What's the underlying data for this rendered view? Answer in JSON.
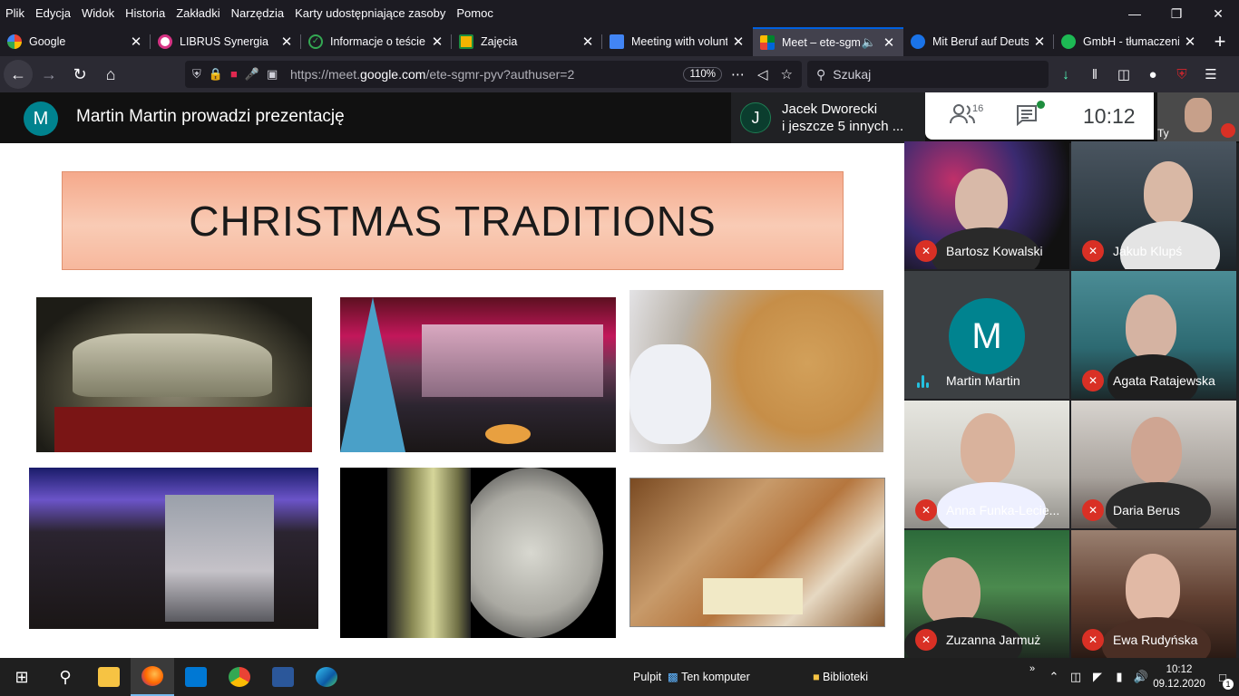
{
  "menubar": {
    "items": [
      "Plik",
      "Edycja",
      "Widok",
      "Historia",
      "Zakładki",
      "Narzędzia",
      "Karty udostępniające zasoby",
      "Pomoc"
    ]
  },
  "tabs": [
    {
      "label": "Google",
      "icon": "google-icon",
      "color": "#4285f4"
    },
    {
      "label": "LIBRUS Synergia",
      "icon": "librus-icon",
      "color": "#d63384"
    },
    {
      "label": "Informacje o teście",
      "icon": "check-icon",
      "color": "#1e8e3e"
    },
    {
      "label": "Zajęcia",
      "icon": "classroom-icon",
      "color": "#f4b400"
    },
    {
      "label": "Meeting with volunt",
      "icon": "contacts-icon",
      "color": "#4285f4"
    },
    {
      "label": "Meet – ete-sgmr",
      "icon": "meet-icon",
      "color": "#00832d"
    },
    {
      "label": "Mit Beruf auf Deuts",
      "icon": "globe-icon",
      "color": "#1a73e8"
    },
    {
      "label": "GmbH - tłumaczeni",
      "icon": "circle-icon",
      "color": "#1db954"
    }
  ],
  "navbar": {
    "url_prefix": "https://meet.",
    "url_domain": "google.com",
    "url_path": "/ete-sgmr-pyv?authuser=2",
    "zoom": "110%",
    "search_placeholder": "Szukaj"
  },
  "meet": {
    "presenter_initial": "M",
    "presenter_text": "Martin Martin prowadzi prezentację",
    "joined_initial": "J",
    "joined_line1": "Jacek Dworecki",
    "joined_line2": "i jeszcze 5 innych ...",
    "participant_count": "16",
    "time": "10:12",
    "self_label": "Ty",
    "slide_title": "CHRISTMAS TRADITIONS",
    "participants": [
      {
        "name": "Bartosz Kowalski",
        "muted": true
      },
      {
        "name": "Jakub Klupś",
        "muted": true
      },
      {
        "name": "Martin Martin",
        "muted": false,
        "initial": "M"
      },
      {
        "name": "Agata Ratajewska",
        "muted": true
      },
      {
        "name": "Anna Funka-Lecie...",
        "muted": true
      },
      {
        "name": "Daria Berus",
        "muted": true
      },
      {
        "name": "Zuzanna Jarmuż",
        "muted": true
      },
      {
        "name": "Ewa Rudyńska",
        "muted": true
      }
    ]
  },
  "taskbar": {
    "desktop_label": "Pulpit",
    "computer_label": "Ten komputer",
    "libraries_label": "Biblioteki",
    "time": "10:12",
    "date": "09.12.2020",
    "notifications": "1"
  },
  "colors": {
    "meet_accent": "#00838f",
    "mic_muted": "#d93025",
    "firefox_blue": "#0060df"
  }
}
